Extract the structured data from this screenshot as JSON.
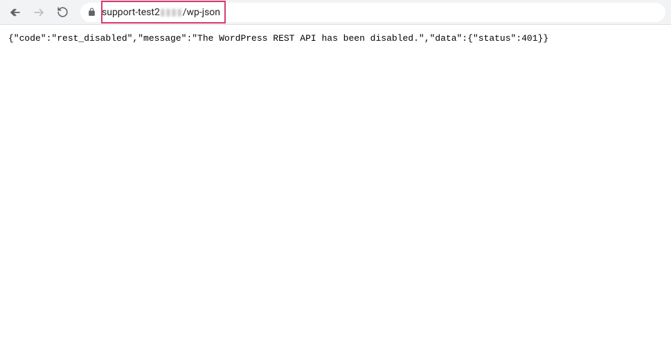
{
  "toolbar": {
    "url_prefix": "support-test2",
    "url_blurred": "▮▮▮▮",
    "url_suffix": "/wp-json"
  },
  "page": {
    "body_text": "{\"code\":\"rest_disabled\",\"message\":\"The WordPress REST API has been disabled.\",\"data\":{\"status\":401}}"
  }
}
